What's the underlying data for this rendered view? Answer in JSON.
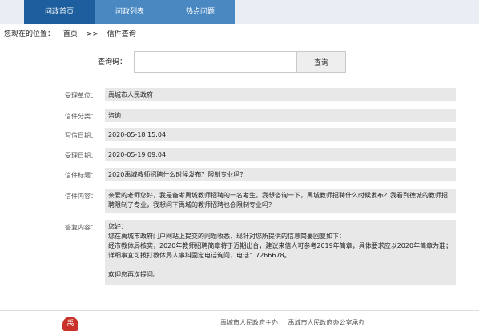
{
  "nav": {
    "tabs": [
      "问政首页",
      "问政列表",
      "热点问题"
    ]
  },
  "breadcrumb": {
    "prefix": "您现在的位置：",
    "home": "首页",
    "separator": ">>",
    "current": "信件查询"
  },
  "query": {
    "label": "查询码：",
    "value": "",
    "button_label": "查询"
  },
  "letter": {
    "dept_label": "受理单位：",
    "dept_value": "禹城市人民政府",
    "category_label": "信件分类：",
    "category_value": "咨询",
    "write_date_label": "写信日期：",
    "write_date_value": "2020-05-18 15:04",
    "accept_date_label": "受理日期：",
    "accept_date_value": "2020-05-19 09:04",
    "title_label": "信件标题：",
    "title_value": "2020禹城教师招聘什么时候发布？限制专业吗？",
    "content_label": "信件内容：",
    "content_value": "亲爱的老师您好，我是备考禹城教师招聘的一名考生，我想咨询一下，禹城教师招聘什么时候发布？我看到德城的教师招聘限制了专业，我想问下禹城的教师招聘也会限制专业吗？",
    "reply_label": "答复内容：",
    "reply_greeting": "您好：",
    "reply_line1": "您在禹城市政府门户网站上提交的问题收悉，现针对您所提供的信息简要回复如下：",
    "reply_line2": "经市教体局核实，2020年教师招聘简章将于近期出台，建议来信人可参考2019年简章，具体要求应以2020年简章为准；详细事宜可拨打教体局人事科固定电话询问，电话：7266678。",
    "reply_closing": "欢迎您再次提问。"
  },
  "footer": {
    "emblem_char": "禹",
    "sponsor": "禹城市人民政府主办",
    "organizer": "禹城市人民政府办公室承办"
  }
}
